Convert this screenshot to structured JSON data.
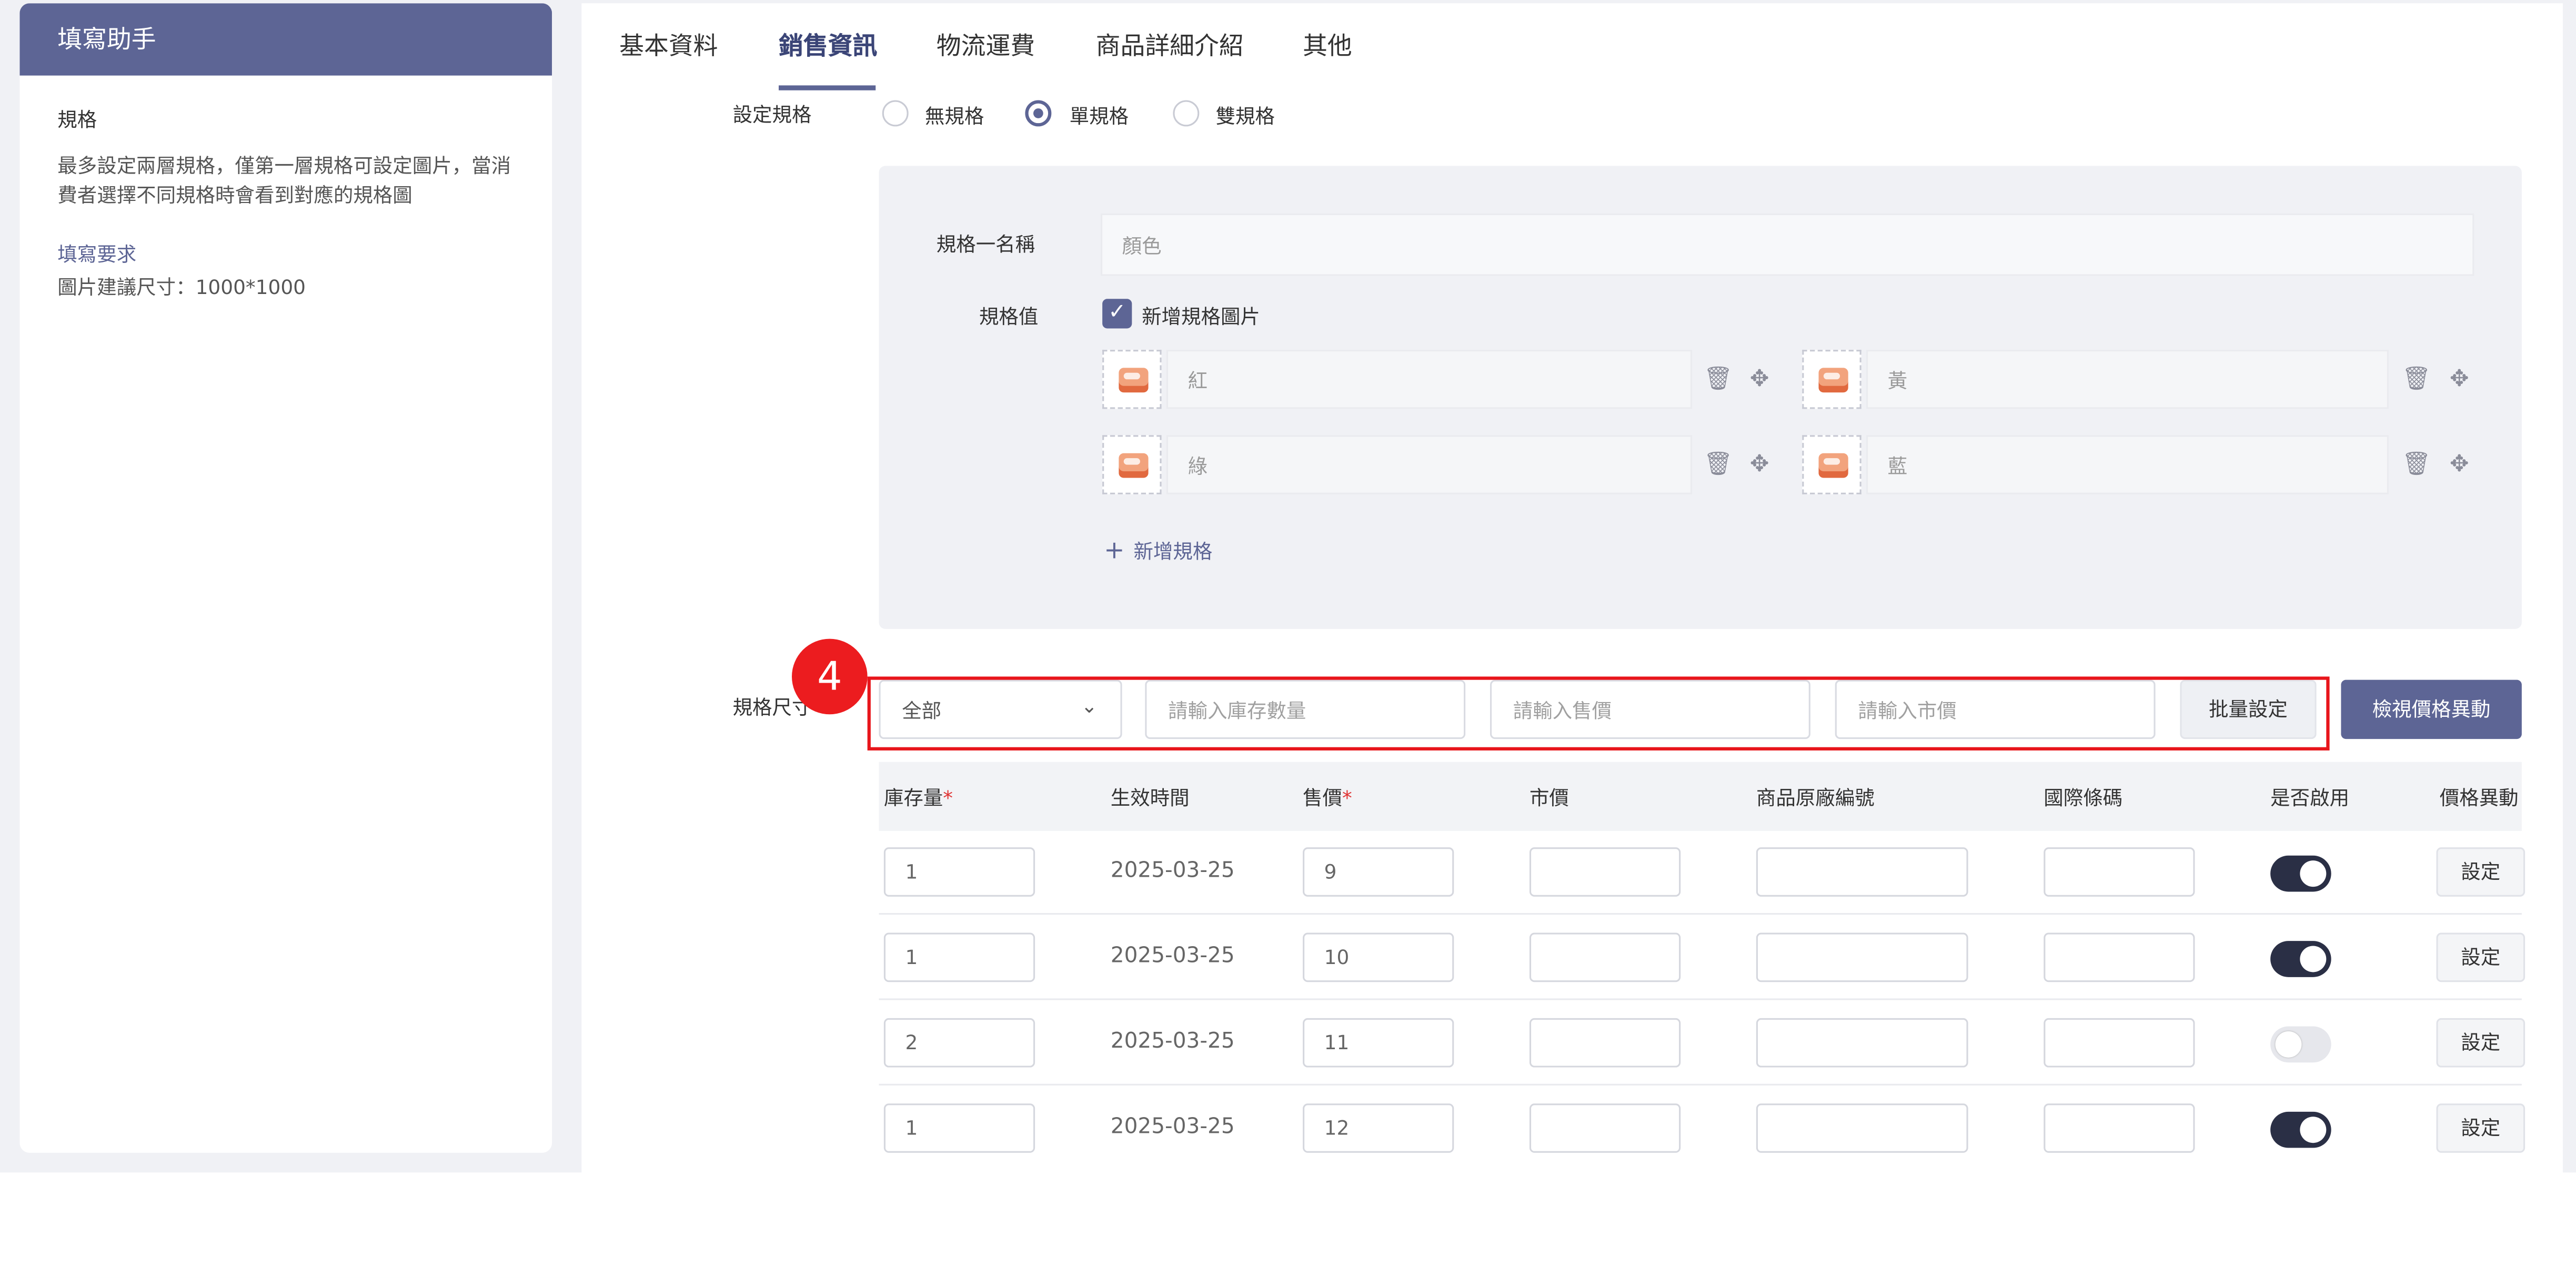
{
  "helper": {
    "title": "填寫助手",
    "section_title": "規格",
    "section_body": "最多設定兩層規格，僅第一層規格可設定圖片，當消費者選擇不同規格時會看到對應的規格圖",
    "req_title": "填寫要求",
    "req_body": "圖片建議尺寸：1000*1000"
  },
  "tabs": [
    "基本資料",
    "銷售資訊",
    "物流運費",
    "商品詳細介紹",
    "其他"
  ],
  "active_tab": "銷售資訊",
  "spec_setting": {
    "label": "設定規格",
    "options": [
      "無規格",
      "單規格",
      "雙規格"
    ],
    "selected": "單規格"
  },
  "spec_one": {
    "name_label": "規格一名稱",
    "name_placeholder": "顏色",
    "value_label": "規格值",
    "add_image_label": "新增規格圖片",
    "add_image_checked": true,
    "values": [
      "紅",
      "黃",
      "綠",
      "藍"
    ],
    "add_spec_label": "新增規格"
  },
  "spec_size": {
    "label": "規格尺寸",
    "filter_select": "全部",
    "stock_placeholder": "請輸入庫存數量",
    "price_placeholder": "請輸入售價",
    "market_placeholder": "請輸入市價",
    "batch_button": "批量設定",
    "view_button": "檢視價格異動"
  },
  "table": {
    "headers": [
      "庫存量",
      "生效時間",
      "售價",
      "市價",
      "商品原廠編號",
      "國際條碼",
      "是否啟用",
      "價格異動"
    ],
    "required_mark": "*",
    "set_label": "設定",
    "rows": [
      {
        "stock": "1",
        "date": "2025-03-25",
        "price": "9",
        "enabled": true
      },
      {
        "stock": "1",
        "date": "2025-03-25",
        "price": "10",
        "enabled": true
      },
      {
        "stock": "2",
        "date": "2025-03-25",
        "price": "11",
        "enabled": false
      },
      {
        "stock": "1",
        "date": "2025-03-25",
        "price": "12",
        "enabled": true
      }
    ]
  },
  "annotation": {
    "marker": "4",
    "color": "#e8151b"
  },
  "colors": {
    "brand": "#5d6595",
    "toggle_on": "#2a2f45"
  }
}
